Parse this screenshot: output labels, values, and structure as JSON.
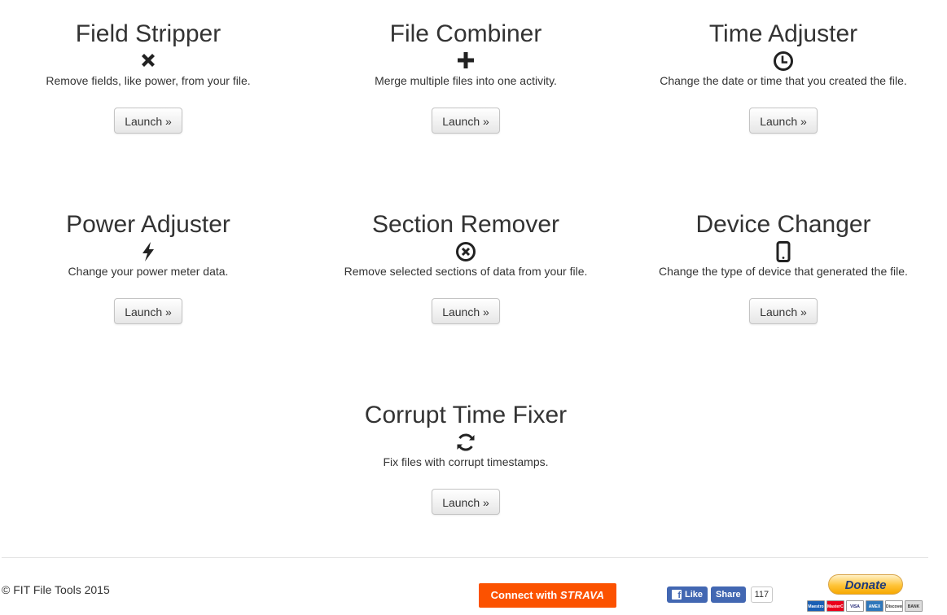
{
  "tools": [
    {
      "title": "Field Stripper",
      "icon": "times-icon",
      "description": "Remove fields, like power, from your file.",
      "button": "Launch »"
    },
    {
      "title": "File Combiner",
      "icon": "plus-icon",
      "description": "Merge multiple files into one activity.",
      "button": "Launch »"
    },
    {
      "title": "Time Adjuster",
      "icon": "clock-icon",
      "description": "Change the date or time that you created the file.",
      "button": "Launch »"
    },
    {
      "title": "Power Adjuster",
      "icon": "bolt-icon",
      "description": "Change your power meter data.",
      "button": "Launch »"
    },
    {
      "title": "Section Remover",
      "icon": "remove-circle-icon",
      "description": "Remove selected sections of data from your file.",
      "button": "Launch »"
    },
    {
      "title": "Device Changer",
      "icon": "phone-icon",
      "description": "Change the type of device that generated the file.",
      "button": "Launch »"
    },
    {
      "title": "Corrupt Time Fixer",
      "icon": "refresh-icon",
      "description": "Fix files with corrupt timestamps.",
      "button": "Launch »"
    }
  ],
  "footer": {
    "copyright": "© FIT File Tools 2015",
    "strava": {
      "prefix": "Connect with",
      "brand": "STRAVA",
      "color": "#fc5200"
    },
    "facebook": {
      "like": "Like",
      "share": "Share",
      "count": "117",
      "logo": "f",
      "color": "#4267b2"
    },
    "paypal": {
      "donate": "Donate",
      "cards": [
        "Maestro",
        "MasterCard",
        "VISA",
        "AMEX",
        "Discover",
        "BANK"
      ]
    }
  }
}
